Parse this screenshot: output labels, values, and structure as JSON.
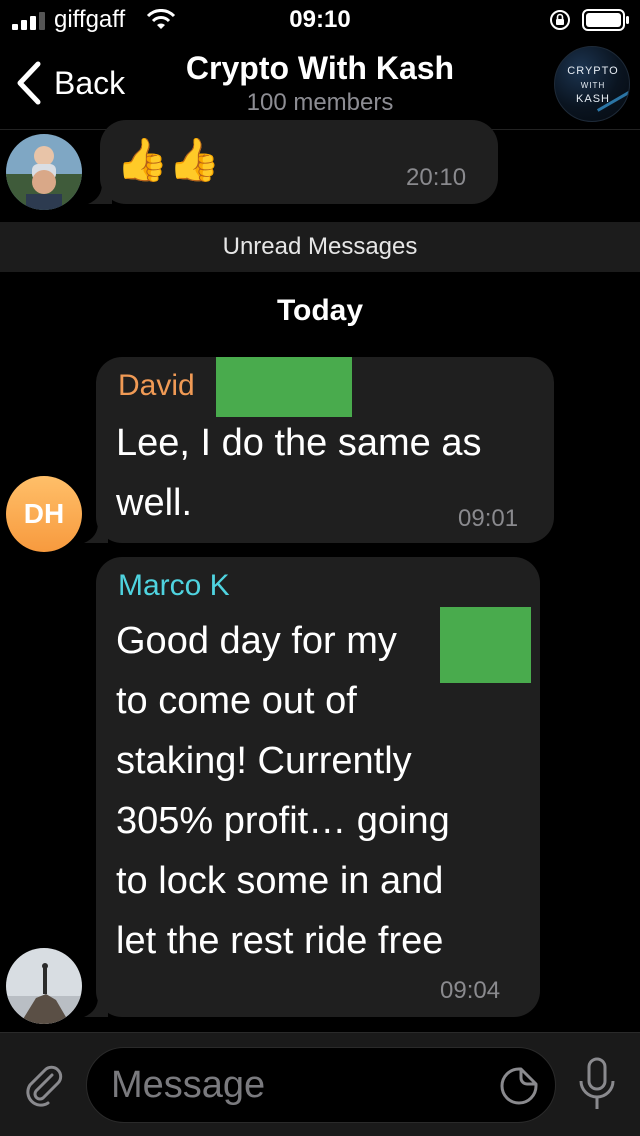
{
  "status_bar": {
    "carrier": "giffgaff",
    "time": "09:10"
  },
  "header": {
    "back_label": "Back",
    "title": "Crypto With Kash",
    "subtitle": "100 members",
    "channel_avatar": {
      "line1": "CRYPTO",
      "line2": "WITH",
      "line3": "KASH"
    }
  },
  "messages": [
    {
      "text": "👍👍",
      "time": "20:10"
    },
    {
      "sender": "David",
      "sender_color": "#f09a55",
      "avatar_initials": "DH",
      "text_lines": [
        "Lee, I do the same as",
        "well."
      ],
      "time": "09:01"
    },
    {
      "sender": "Marco K",
      "sender_color": "#4fd3df",
      "text_lines": [
        "Good day for my",
        "to come out of",
        "staking! Currently",
        "305% profit… going",
        "to lock some in and",
        "let the rest ride free"
      ],
      "time": "09:04"
    }
  ],
  "unread_banner": "Unread Messages",
  "date_separator": "Today",
  "composer": {
    "placeholder": "Message"
  },
  "colors": {
    "background": "#000000",
    "bubble": "#1f1f1f",
    "redaction": "#49ab4d"
  }
}
